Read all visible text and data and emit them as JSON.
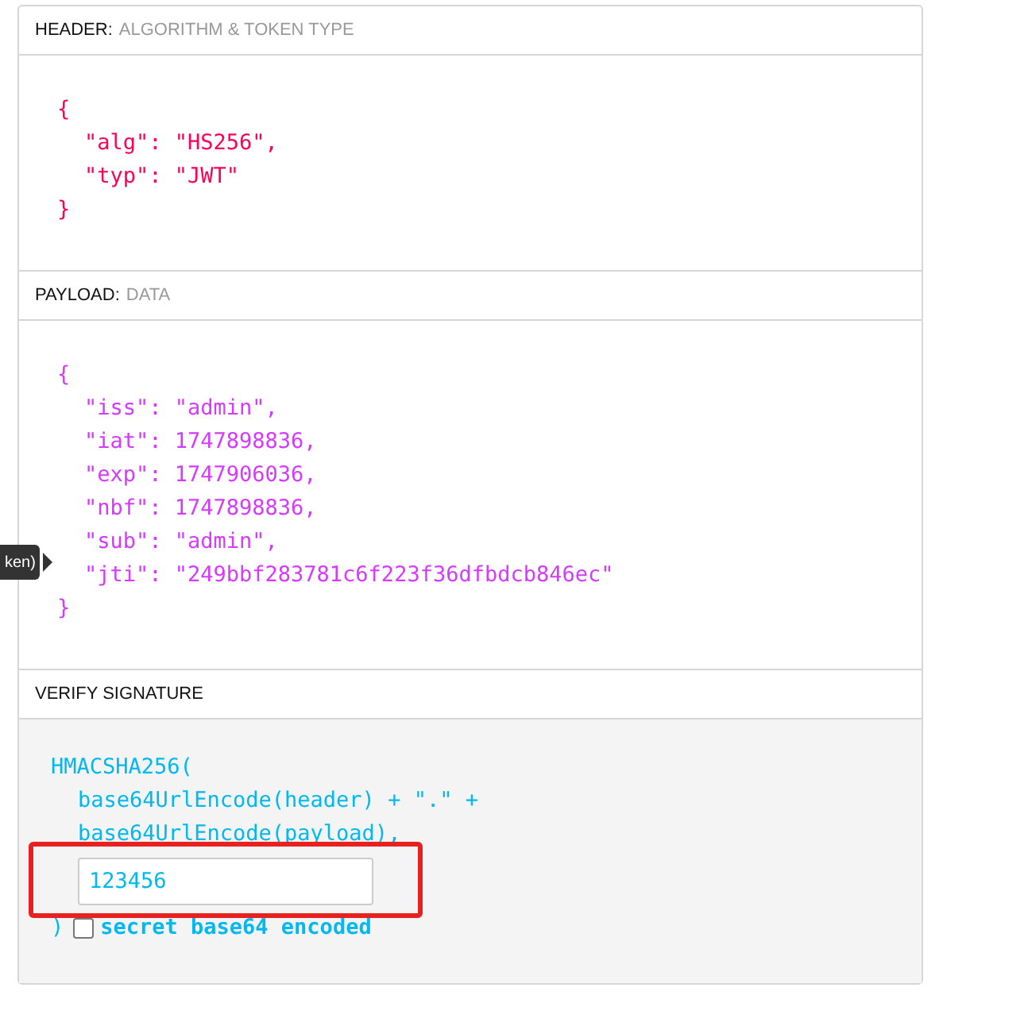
{
  "tooltip": {
    "text": "ken)"
  },
  "sections": [
    {
      "kind": "header",
      "title": "HEADER:",
      "subtitle": "ALGORITHM & TOKEN TYPE",
      "open": "{",
      "entries": [
        "\"alg\": \"HS256\",",
        "\"typ\": \"JWT\""
      ],
      "close": "}"
    },
    {
      "kind": "payload",
      "title": "PAYLOAD:",
      "subtitle": "DATA",
      "open": "{",
      "entries": [
        "\"iss\": \"admin\",",
        "\"iat\": 1747898836,",
        "\"exp\": 1747906036,",
        "\"nbf\": 1747898836,",
        "\"sub\": \"admin\",",
        "\"jti\": \"249bbf283781c6f223f36dfbdcb846ec\""
      ],
      "close": "}"
    },
    {
      "kind": "signature",
      "title": "VERIFY SIGNATURE",
      "open": "HMACSHA256(",
      "entries": [
        "base64UrlEncode(header) + \".\" +",
        "base64UrlEncode(payload),"
      ],
      "secret": {
        "value": "123456"
      },
      "close": ")",
      "base64": {
        "label": "secret base64 encoded",
        "checked": false
      }
    }
  ]
}
